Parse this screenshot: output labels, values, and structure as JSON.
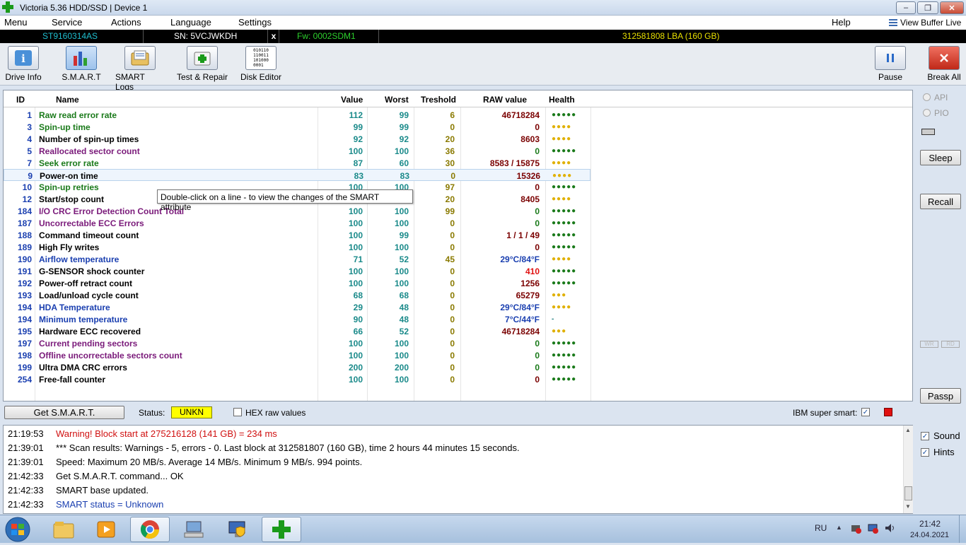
{
  "window": {
    "title": "Victoria 5.36 HDD/SSD | Device 1",
    "buttons": {
      "minimize": "–",
      "restore": "❐",
      "close": "✕"
    }
  },
  "menu": {
    "items": [
      "Menu",
      "Service",
      "Actions",
      "Language",
      "Settings"
    ],
    "help": "Help",
    "view_buffer": "View Buffer Live"
  },
  "device": {
    "model": "ST9160314AS",
    "serial": "SN: 5VCJWKDH",
    "close": "x",
    "firmware": "Fw: 0002SDM1",
    "lba": "312581808 LBA (160 GB)"
  },
  "toolbar": {
    "drive_info": "Drive Info",
    "smart": "S.M.A.R.T",
    "smart_logs": "SMART Logs",
    "test_repair": "Test & Repair",
    "disk_editor": "Disk Editor",
    "disk_editor_icon_text": "010110\n110011\n101000\n0001",
    "pause": "Pause",
    "break_all": "Break All"
  },
  "table": {
    "headers": [
      "ID",
      "Name",
      "Value",
      "Worst",
      "Treshold",
      "RAW value",
      "Health"
    ],
    "rows": [
      {
        "id": "1",
        "name": "Raw read error rate",
        "value": "112",
        "worst": "99",
        "thr": "6",
        "raw": "46718284",
        "health": "●●●●●",
        "nc": "#1a7a1a",
        "rc": "#7a0000",
        "hc": "#1a7a1a"
      },
      {
        "id": "3",
        "name": "Spin-up time",
        "value": "99",
        "worst": "99",
        "thr": "0",
        "raw": "0",
        "health": "●●●●",
        "nc": "#1a7a1a",
        "rc": "#7a0000",
        "hc": "#e0b000"
      },
      {
        "id": "4",
        "name": "Number of spin-up times",
        "value": "92",
        "worst": "92",
        "thr": "20",
        "raw": "8603",
        "health": "●●●●",
        "nc": "#000000",
        "rc": "#7a0000",
        "hc": "#e0b000"
      },
      {
        "id": "5",
        "name": "Reallocated sector count",
        "value": "100",
        "worst": "100",
        "thr": "36",
        "raw": "0",
        "health": "●●●●●",
        "nc": "#7a1a7a",
        "rc": "#1a7a1a",
        "hc": "#1a7a1a"
      },
      {
        "id": "7",
        "name": "Seek error rate",
        "value": "87",
        "worst": "60",
        "thr": "30",
        "raw": "8583 / 15875",
        "health": "●●●●",
        "nc": "#1a7a1a",
        "rc": "#7a0000",
        "hc": "#e0b000"
      },
      {
        "id": "9",
        "name": "Power-on time",
        "value": "83",
        "worst": "83",
        "thr": "0",
        "raw": "15326",
        "health": "●●●●",
        "nc": "#000000",
        "rc": "#7a0000",
        "hc": "#e0b000"
      },
      {
        "id": "10",
        "name": "Spin-up retries",
        "value": "100",
        "worst": "100",
        "thr": "97",
        "raw": "0",
        "health": "●●●●●",
        "nc": "#1a7a1a",
        "rc": "#7a0000",
        "hc": "#1a7a1a"
      },
      {
        "id": "12",
        "name": "Start/stop count",
        "value": "",
        "worst": "",
        "thr": "20",
        "raw": "8405",
        "health": "●●●●",
        "nc": "#000000",
        "rc": "#7a0000",
        "hc": "#e0b000"
      },
      {
        "id": "184",
        "name": "I/O CRC Error Detection Count Total",
        "value": "100",
        "worst": "100",
        "thr": "99",
        "raw": "0",
        "health": "●●●●●",
        "nc": "#7a1a7a",
        "rc": "#1a7a1a",
        "hc": "#1a7a1a"
      },
      {
        "id": "187",
        "name": "Uncorrectable ECC Errors",
        "value": "100",
        "worst": "100",
        "thr": "0",
        "raw": "0",
        "health": "●●●●●",
        "nc": "#7a1a7a",
        "rc": "#1a7a1a",
        "hc": "#1a7a1a"
      },
      {
        "id": "188",
        "name": "Command timeout count",
        "value": "100",
        "worst": "99",
        "thr": "0",
        "raw": "1 / 1 / 49",
        "health": "●●●●●",
        "nc": "#000000",
        "rc": "#7a0000",
        "hc": "#1a7a1a"
      },
      {
        "id": "189",
        "name": "High Fly writes",
        "value": "100",
        "worst": "100",
        "thr": "0",
        "raw": "0",
        "health": "●●●●●",
        "nc": "#000000",
        "rc": "#7a0000",
        "hc": "#1a7a1a"
      },
      {
        "id": "190",
        "name": "Airflow temperature",
        "value": "71",
        "worst": "52",
        "thr": "45",
        "raw": "29°C/84°F",
        "health": "●●●●",
        "nc": "#1a3fb0",
        "rc": "#1a3fb0",
        "hc": "#e0b000"
      },
      {
        "id": "191",
        "name": "G-SENSOR shock counter",
        "value": "100",
        "worst": "100",
        "thr": "0",
        "raw": "410",
        "health": "●●●●●",
        "nc": "#000000",
        "rc": "#e01010",
        "hc": "#1a7a1a"
      },
      {
        "id": "192",
        "name": "Power-off retract count",
        "value": "100",
        "worst": "100",
        "thr": "0",
        "raw": "1256",
        "health": "●●●●●",
        "nc": "#000000",
        "rc": "#7a0000",
        "hc": "#1a7a1a"
      },
      {
        "id": "193",
        "name": "Load/unload cycle count",
        "value": "68",
        "worst": "68",
        "thr": "0",
        "raw": "65279",
        "health": "●●●",
        "nc": "#000000",
        "rc": "#7a0000",
        "hc": "#e0b000"
      },
      {
        "id": "194",
        "name": "HDA Temperature",
        "value": "29",
        "worst": "48",
        "thr": "0",
        "raw": "29°C/84°F",
        "health": "●●●●",
        "nc": "#1a3fb0",
        "rc": "#1a3fb0",
        "hc": "#e0b000"
      },
      {
        "id": "194",
        "name": "Minimum temperature",
        "value": "90",
        "worst": "48",
        "thr": "0",
        "raw": "7°C/44°F",
        "health": "-",
        "nc": "#1a3fb0",
        "rc": "#1a3fb0",
        "hc": "#1a7a7a"
      },
      {
        "id": "195",
        "name": "Hardware ECC recovered",
        "value": "66",
        "worst": "52",
        "thr": "0",
        "raw": "46718284",
        "health": "●●●",
        "nc": "#000000",
        "rc": "#7a0000",
        "hc": "#e0b000"
      },
      {
        "id": "197",
        "name": "Current pending sectors",
        "value": "100",
        "worst": "100",
        "thr": "0",
        "raw": "0",
        "health": "●●●●●",
        "nc": "#7a1a7a",
        "rc": "#1a7a1a",
        "hc": "#1a7a1a"
      },
      {
        "id": "198",
        "name": "Offline uncorrectable sectors count",
        "value": "100",
        "worst": "100",
        "thr": "0",
        "raw": "0",
        "health": "●●●●●",
        "nc": "#7a1a7a",
        "rc": "#1a7a1a",
        "hc": "#1a7a1a"
      },
      {
        "id": "199",
        "name": "Ultra DMA CRC errors",
        "value": "200",
        "worst": "200",
        "thr": "0",
        "raw": "0",
        "health": "●●●●●",
        "nc": "#000000",
        "rc": "#1a7a1a",
        "hc": "#1a7a1a"
      },
      {
        "id": "254",
        "name": "Free-fall counter",
        "value": "100",
        "worst": "100",
        "thr": "0",
        "raw": "0",
        "health": "●●●●●",
        "nc": "#000000",
        "rc": "#7a0000",
        "hc": "#1a7a1a"
      }
    ]
  },
  "tooltip": "Double-click on a line - to view the changes of the SMART attribute",
  "status": {
    "get_smart": "Get S.M.A.R.T.",
    "status_label": "Status:",
    "status_value": "UNKN",
    "hex_label": "HEX raw values",
    "ibm_label": "IBM super smart:",
    "ibm_check": "✓"
  },
  "right_panel": {
    "api": "API",
    "pio": "PIO",
    "sleep": "Sleep",
    "recall": "Recall",
    "wr": "WR",
    "rd": "RD",
    "passp": "Passp",
    "sound": "Sound",
    "hints": "Hints",
    "check": "✓"
  },
  "log": [
    {
      "time": "21:19:53",
      "text": "Warning! Block start at 275216128 (141 GB)  = 234 ms",
      "color": "#d01010"
    },
    {
      "time": "21:39:01",
      "text": "*** Scan results: Warnings - 5, errors - 0. Last block at 312581807 (160 GB), time 2 hours 44 minutes 15 seconds.",
      "color": "#000000"
    },
    {
      "time": "21:39:01",
      "text": "Speed: Maximum 20 MB/s. Average 14 MB/s. Minimum 9 MB/s. 994 points.",
      "color": "#000000"
    },
    {
      "time": "21:42:33",
      "text": "Get S.M.A.R.T. command... OK",
      "color": "#000000"
    },
    {
      "time": "21:42:33",
      "text": "SMART base updated.",
      "color": "#000000"
    },
    {
      "time": "21:42:33",
      "text": "SMART status = Unknown",
      "color": "#1a3fb0"
    }
  ],
  "taskbar": {
    "lang": "RU",
    "time": "21:42",
    "date": "24.04.2021"
  },
  "colors": {
    "status_bg": "#ffff00",
    "accent_cyan": "#1fbfcf",
    "fw_green": "#2dd02d",
    "lba_yellow": "#e8e000"
  }
}
